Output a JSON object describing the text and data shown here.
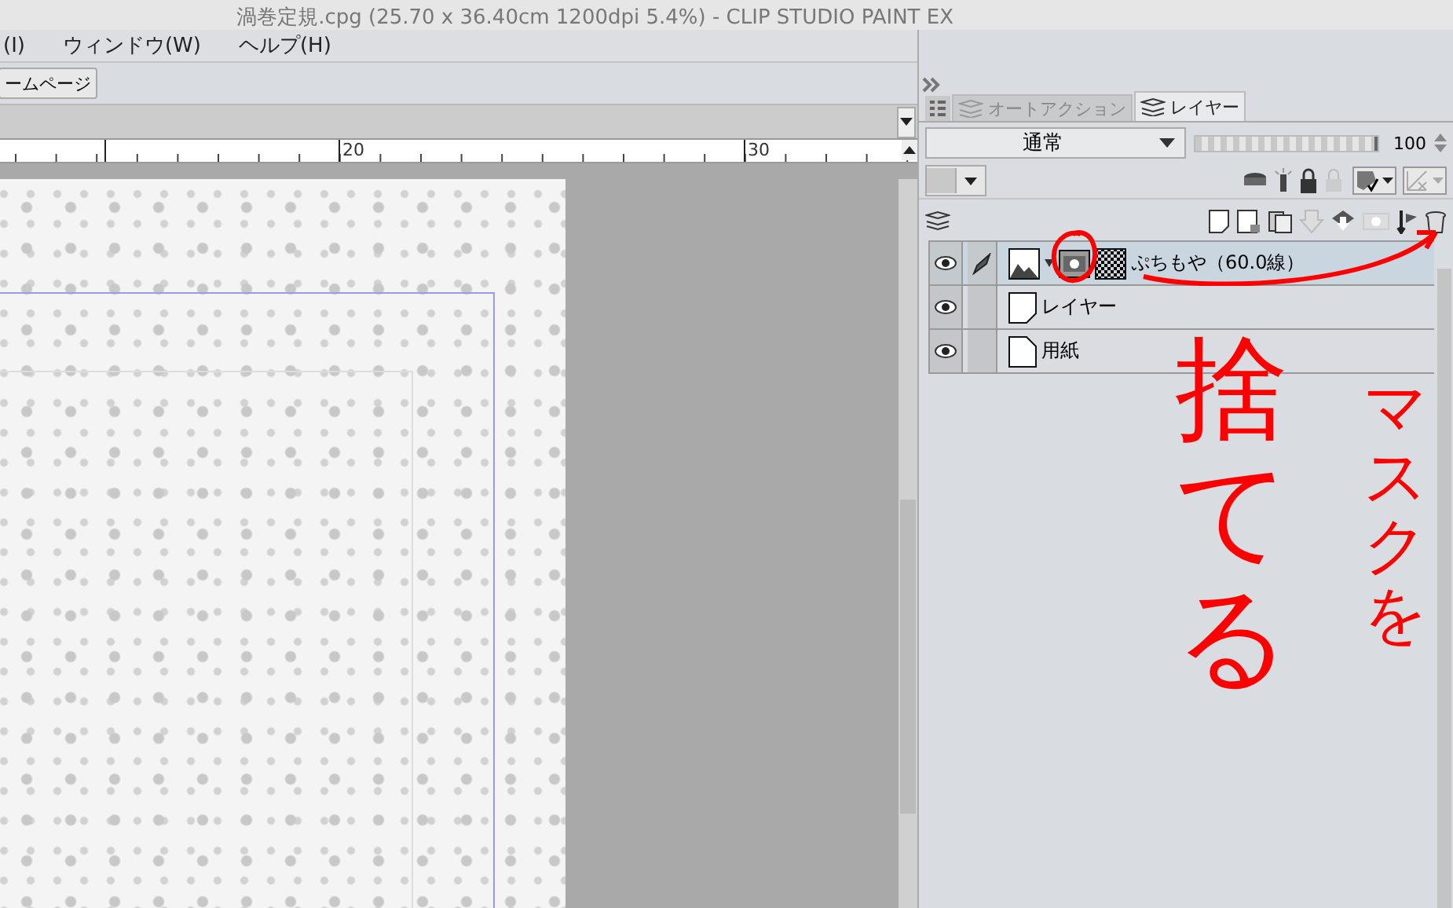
{
  "window": {
    "title": "渦巻定規.cpg (25.70 x 36.40cm 1200dpi 5.4%)  - CLIP STUDIO PAINT EX"
  },
  "menu": [
    "(I)",
    "ウィンドウ(W)",
    "ヘルプ(H)"
  ],
  "toolbar": {
    "button": "ームページ"
  },
  "ruler": {
    "labels": [
      "20",
      "30"
    ]
  },
  "panel": {
    "tabs": [
      {
        "label": "オートアクション",
        "selected": false
      },
      {
        "label": "レイヤー",
        "selected": true
      }
    ],
    "blend_mode": "通常",
    "opacity": {
      "level": 1.0,
      "value": "100"
    },
    "layers": [
      {
        "name": "ぷちもや（60.0線）",
        "kind": "masked",
        "visible": true,
        "selected": true
      },
      {
        "name": "レイヤー",
        "kind": "raster",
        "visible": true,
        "selected": false
      },
      {
        "name": "用紙",
        "kind": "paper",
        "visible": true,
        "selected": false
      }
    ]
  },
  "annotations": [
    {
      "text": "捨てる"
    },
    {
      "text": "マスクを"
    }
  ]
}
